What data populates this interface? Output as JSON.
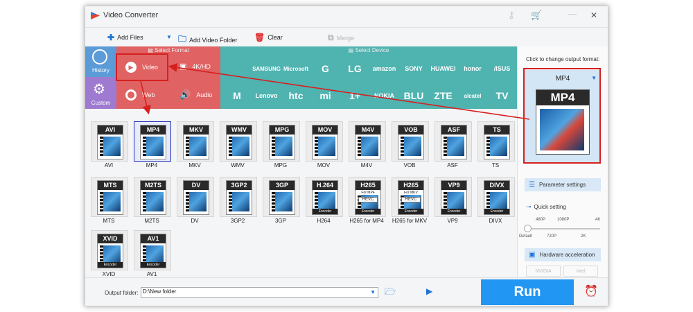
{
  "window": {
    "title": "Video Converter",
    "icons": {
      "key": "key-icon",
      "cart": "cart-icon",
      "minimize": "minimize-icon",
      "close": "close-icon"
    }
  },
  "toolbar": {
    "add_files": "Add Files",
    "add_folder": "Add Video Folder",
    "clear": "Clear",
    "merge": "Merge"
  },
  "format_panel": {
    "select_format": "Select Format",
    "select_device": "Select Device",
    "history": "History",
    "custom": "Custom",
    "categories": [
      {
        "label": "Video",
        "icon": "play-icon"
      },
      {
        "label": "4K/HD",
        "icon": "4k-icon"
      },
      {
        "label": "Web",
        "icon": "chrome-icon"
      },
      {
        "label": "Audio",
        "icon": "speaker-icon"
      }
    ],
    "brands_row1": [
      "",
      "SAMSUNG",
      "Microsoft",
      "G",
      "LG",
      "amazon",
      "SONY",
      "HUAWEI",
      "honor",
      "/ISUS"
    ],
    "brands_row2": [
      "M",
      "Lenovo",
      "htc",
      "mi",
      "1+",
      "NOKIA",
      "BLU",
      "ZTE",
      "alcatel",
      "TV"
    ]
  },
  "formats": [
    {
      "label": "AVI",
      "tag": "AVI"
    },
    {
      "label": "MP4",
      "tag": "MP4"
    },
    {
      "label": "MKV",
      "tag": "MKV"
    },
    {
      "label": "WMV",
      "tag": "WMV"
    },
    {
      "label": "MPG",
      "tag": "MPG"
    },
    {
      "label": "MOV",
      "tag": "MOV"
    },
    {
      "label": "M4V",
      "tag": "M4V"
    },
    {
      "label": "VOB",
      "tag": "VOB"
    },
    {
      "label": "ASF",
      "tag": "ASF"
    },
    {
      "label": "TS",
      "tag": "TS"
    },
    {
      "label": "MTS",
      "tag": "MTS"
    },
    {
      "label": "M2TS",
      "tag": "M2TS"
    },
    {
      "label": "DV",
      "tag": "DV"
    },
    {
      "label": "3GP2",
      "tag": "3GP2"
    },
    {
      "label": "3GP",
      "tag": "3GP"
    },
    {
      "label": "H264",
      "tag": "H.264",
      "sub": "Encoder"
    },
    {
      "label": "H265 for MP4",
      "tag": "H265",
      "sub": "Encoder",
      "top": "For MP4",
      "mid": "HEVC"
    },
    {
      "label": "H265 for MKV",
      "tag": "H265",
      "sub": "Encoder",
      "top": "For MKV",
      "mid": "HEVC"
    },
    {
      "label": "VP9",
      "tag": "VP9",
      "sub": "Encoder"
    },
    {
      "label": "DIVX",
      "tag": "DIVX",
      "sub": "Encoder"
    },
    {
      "label": "XVID",
      "tag": "XVID",
      "sub": "Encoder"
    },
    {
      "label": "AV1",
      "tag": "AV1",
      "sub": "Encoder"
    }
  ],
  "output": {
    "hint": "Click to change output format:",
    "format": "MP4",
    "big_tag": "MP4",
    "parameter_settings": "Parameter settings",
    "quick_setting": "Quick setting",
    "quality_top": [
      "480P",
      "1080P",
      "4K"
    ],
    "quality_bottom": [
      "Default",
      "720P",
      "2K"
    ],
    "hardware_acceleration": "Hardware acceleration",
    "nvidia": "NVIDIA",
    "intel": "Intel"
  },
  "bottom": {
    "output_folder_label": "Output folder:",
    "output_folder_value": "D:\\New folder",
    "run": "Run"
  },
  "colors": {
    "red_panel": "#e06262",
    "teal_panel": "#4fb3b0",
    "history_bg": "#5b9bd8",
    "custom_bg": "#9e7bd0",
    "run_bg": "#2196f3",
    "annotation": "#d62020"
  }
}
